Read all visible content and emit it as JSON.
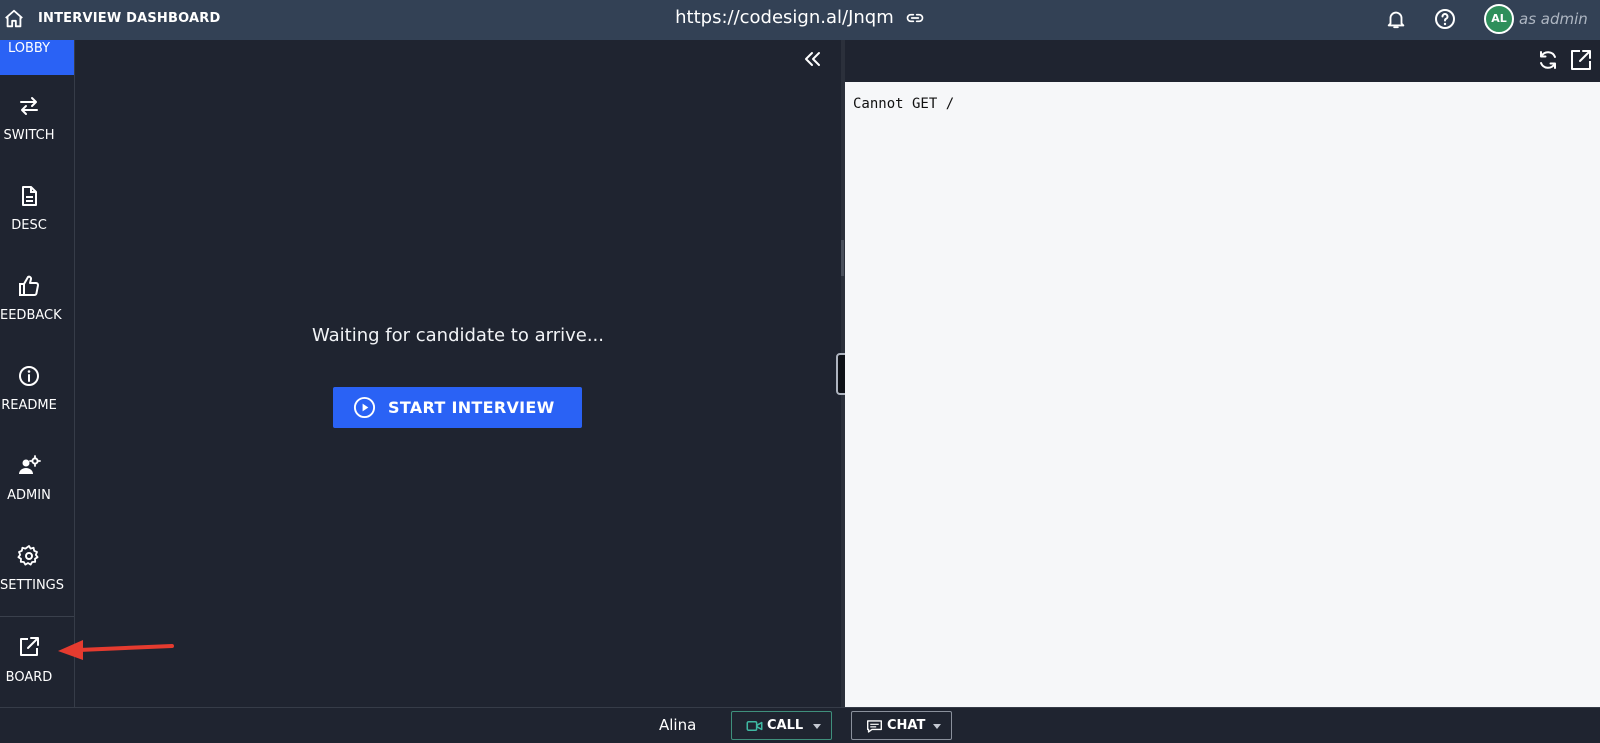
{
  "header": {
    "title": "INTERVIEW DASHBOARD",
    "url": "https://codesign.al/Jnqm",
    "avatar_initials": "AL",
    "role": "as admin"
  },
  "sidebar": {
    "items": [
      {
        "label": "LOBBY",
        "icon": "lobby-icon"
      },
      {
        "label": "SWITCH",
        "icon": "swap-arrows-icon"
      },
      {
        "label": "DESC",
        "icon": "document-icon"
      },
      {
        "label": "EEDBACK",
        "icon": "thumbs-up-icon"
      },
      {
        "label": "README",
        "icon": "info-icon"
      },
      {
        "label": "ADMIN",
        "icon": "user-gear-icon"
      },
      {
        "label": "SETTINGS",
        "icon": "gear-icon"
      },
      {
        "label": "BOARD",
        "icon": "external-link-icon"
      }
    ]
  },
  "main": {
    "waiting_text": "Waiting for candidate to arrive...",
    "start_button": "START INTERVIEW"
  },
  "preview": {
    "content": "Cannot GET /"
  },
  "bottombar": {
    "user": "Alina",
    "call_label": "CALL",
    "chat_label": "CHAT"
  },
  "colors": {
    "accent": "#2a62f5",
    "header_bg": "#334155",
    "panel_bg": "#1f2430",
    "preview_bg": "#f6f7f9",
    "avatar_bg": "#2f8f5b",
    "annotation_arrow": "#e53b2f"
  }
}
